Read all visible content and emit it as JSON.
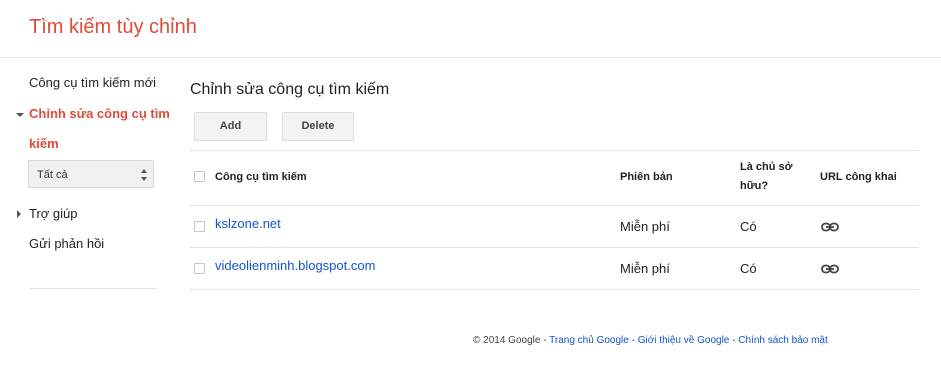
{
  "header": {
    "title": "Tìm kiếm tùy chỉnh"
  },
  "sidebar": {
    "new_engine": "Công cụ tìm kiếm mới",
    "edit_engine": "Chỉnh sửa công cụ tìm kiếm",
    "filter_value": "Tất cả",
    "help": "Trợ giúp",
    "feedback": "Gửi phản hồi"
  },
  "main": {
    "title": "Chỉnh sửa công cụ tìm kiếm",
    "add_label": "Add",
    "delete_label": "Delete",
    "columns": {
      "engine": "Công cụ tìm kiếm",
      "edition": "Phiên bản",
      "owner_line1": "Là chủ sở",
      "owner_line2": "hữu?",
      "public_url": "URL công khai"
    },
    "rows": [
      {
        "name": "kslzone.net",
        "edition": "Miễn phí",
        "owner": "Có",
        "public_url_icon": "link-icon"
      },
      {
        "name": "videolienminh.blogspot.com",
        "edition": "Miễn phí",
        "owner": "Có",
        "public_url_icon": "link-icon"
      }
    ]
  },
  "footer": {
    "copyright": "© 2014 Google",
    "link1": "Trang chủ Google",
    "link2": "Giới thiệu về Google",
    "link3": "Chính sách bảo mật",
    "separator": "-"
  },
  "colors": {
    "accent": "#dd4b39",
    "link": "#1155cc"
  }
}
